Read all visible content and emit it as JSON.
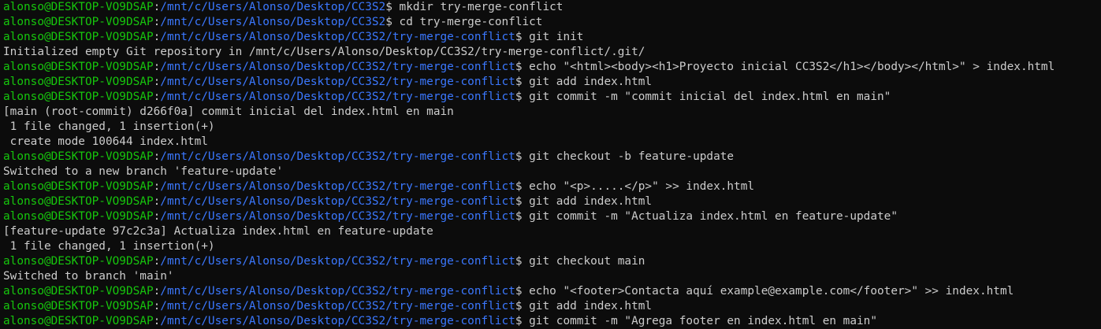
{
  "window": {
    "colors": {
      "background": "#0c0c0c",
      "foreground": "#cccccc",
      "user": "#16c60c",
      "path": "#3b78ff"
    }
  },
  "lines": [
    {
      "type": "prompt",
      "user": "alonso@DESKTOP-VO9DSAP",
      "path": "/mnt/c/Users/Alonso/Desktop/CC3S2",
      "cmd": "mkdir try-merge-conflict"
    },
    {
      "type": "prompt",
      "user": "alonso@DESKTOP-VO9DSAP",
      "path": "/mnt/c/Users/Alonso/Desktop/CC3S2",
      "cmd": "cd try-merge-conflict"
    },
    {
      "type": "prompt",
      "user": "alonso@DESKTOP-VO9DSAP",
      "path": "/mnt/c/Users/Alonso/Desktop/CC3S2/try-merge-conflict",
      "cmd": "git init"
    },
    {
      "type": "output",
      "text": "Initialized empty Git repository in /mnt/c/Users/Alonso/Desktop/CC3S2/try-merge-conflict/.git/"
    },
    {
      "type": "prompt",
      "user": "alonso@DESKTOP-VO9DSAP",
      "path": "/mnt/c/Users/Alonso/Desktop/CC3S2/try-merge-conflict",
      "cmd": "echo \"<html><body><h1>Proyecto inicial CC3S2</h1></body></html>\" > index.html"
    },
    {
      "type": "prompt",
      "user": "alonso@DESKTOP-VO9DSAP",
      "path": "/mnt/c/Users/Alonso/Desktop/CC3S2/try-merge-conflict",
      "cmd": "git add index.html"
    },
    {
      "type": "prompt",
      "user": "alonso@DESKTOP-VO9DSAP",
      "path": "/mnt/c/Users/Alonso/Desktop/CC3S2/try-merge-conflict",
      "cmd": "git commit -m \"commit inicial del index.html en main\""
    },
    {
      "type": "output",
      "text": "[main (root-commit) d266f0a] commit inicial del index.html en main"
    },
    {
      "type": "output",
      "text": " 1 file changed, 1 insertion(+)"
    },
    {
      "type": "output",
      "text": " create mode 100644 index.html"
    },
    {
      "type": "prompt",
      "user": "alonso@DESKTOP-VO9DSAP",
      "path": "/mnt/c/Users/Alonso/Desktop/CC3S2/try-merge-conflict",
      "cmd": "git checkout -b feature-update"
    },
    {
      "type": "output",
      "text": "Switched to a new branch 'feature-update'"
    },
    {
      "type": "prompt",
      "user": "alonso@DESKTOP-VO9DSAP",
      "path": "/mnt/c/Users/Alonso/Desktop/CC3S2/try-merge-conflict",
      "cmd": "echo \"<p>.....</p>\" >> index.html"
    },
    {
      "type": "prompt",
      "user": "alonso@DESKTOP-VO9DSAP",
      "path": "/mnt/c/Users/Alonso/Desktop/CC3S2/try-merge-conflict",
      "cmd": "git add index.html"
    },
    {
      "type": "prompt",
      "user": "alonso@DESKTOP-VO9DSAP",
      "path": "/mnt/c/Users/Alonso/Desktop/CC3S2/try-merge-conflict",
      "cmd": "git commit -m \"Actualiza index.html en feature-update\""
    },
    {
      "type": "output",
      "text": "[feature-update 97c2c3a] Actualiza index.html en feature-update"
    },
    {
      "type": "output",
      "text": " 1 file changed, 1 insertion(+)"
    },
    {
      "type": "prompt",
      "user": "alonso@DESKTOP-VO9DSAP",
      "path": "/mnt/c/Users/Alonso/Desktop/CC3S2/try-merge-conflict",
      "cmd": "git checkout main"
    },
    {
      "type": "output",
      "text": "Switched to branch 'main'"
    },
    {
      "type": "prompt",
      "user": "alonso@DESKTOP-VO9DSAP",
      "path": "/mnt/c/Users/Alonso/Desktop/CC3S2/try-merge-conflict",
      "cmd": "echo \"<footer>Contacta aquí example@example.com</footer>\" >> index.html"
    },
    {
      "type": "prompt",
      "user": "alonso@DESKTOP-VO9DSAP",
      "path": "/mnt/c/Users/Alonso/Desktop/CC3S2/try-merge-conflict",
      "cmd": "git add index.html"
    },
    {
      "type": "prompt",
      "user": "alonso@DESKTOP-VO9DSAP",
      "path": "/mnt/c/Users/Alonso/Desktop/CC3S2/try-merge-conflict",
      "cmd": "git commit -m \"Agrega footer en index.html en main\""
    }
  ]
}
